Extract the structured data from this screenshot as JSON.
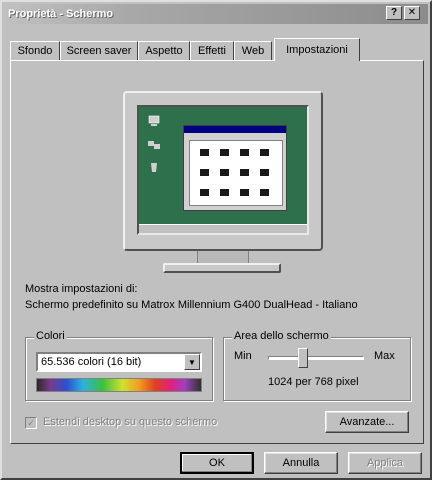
{
  "window": {
    "title": "Proprietà - Schermo",
    "help_glyph": "?",
    "close_glyph": "✕"
  },
  "tabs": [
    {
      "label": "Sfondo"
    },
    {
      "label": "Screen saver"
    },
    {
      "label": "Aspetto"
    },
    {
      "label": "Effetti"
    },
    {
      "label": "Web"
    },
    {
      "label": "Impostazioni",
      "active": true
    }
  ],
  "display_info": {
    "heading": "Mostra impostazioni di:",
    "device": "Schermo predefinito su Matrox Millennium G400 DualHead - Italiano"
  },
  "colors_group": {
    "title": "Colori",
    "selected_value": "65.536 colori (16 bit)"
  },
  "screen_area_group": {
    "title": "Area dello schermo",
    "min_label": "Min",
    "max_label": "Max",
    "resolution": "1024 per 768 pixel",
    "slider_level": 0.35
  },
  "extend_desktop": {
    "label": "Estendi desktop su questo schermo",
    "checked": true,
    "enabled": false
  },
  "buttons": {
    "advanced": "Avanzate...",
    "ok": "OK",
    "cancel": "Annulla",
    "apply": "Applica"
  }
}
